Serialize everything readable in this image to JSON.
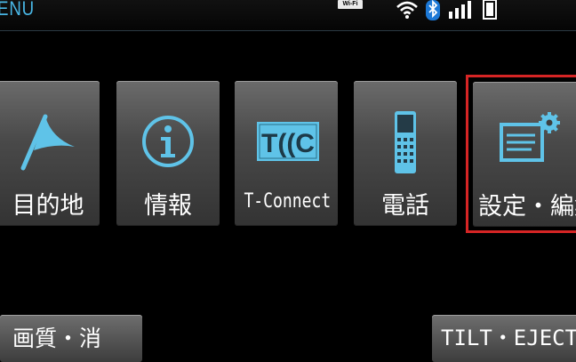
{
  "header": {
    "title": "ENU",
    "wifi_label": "Wi-Fi",
    "status_icons": [
      "wifi-icon",
      "bluetooth-icon",
      "signal-bars-icon",
      "battery-icon"
    ]
  },
  "menu": {
    "items": [
      {
        "label": "目的地",
        "icon": "flag-icon"
      },
      {
        "label": "情報",
        "icon": "info-icon"
      },
      {
        "label": "T-Connect",
        "icon": "tc-logo-icon"
      },
      {
        "label": "電話",
        "icon": "phone-icon"
      },
      {
        "label": "設定・編集",
        "icon": "settings-document-gear-icon",
        "focused": true
      }
    ]
  },
  "bottom": {
    "picture_button": "画質・消",
    "tilt_button": "TILT・EJECT"
  },
  "colors": {
    "accent": "#49b7e6",
    "icon": "#5fc3e8",
    "focus": "#d62525"
  }
}
